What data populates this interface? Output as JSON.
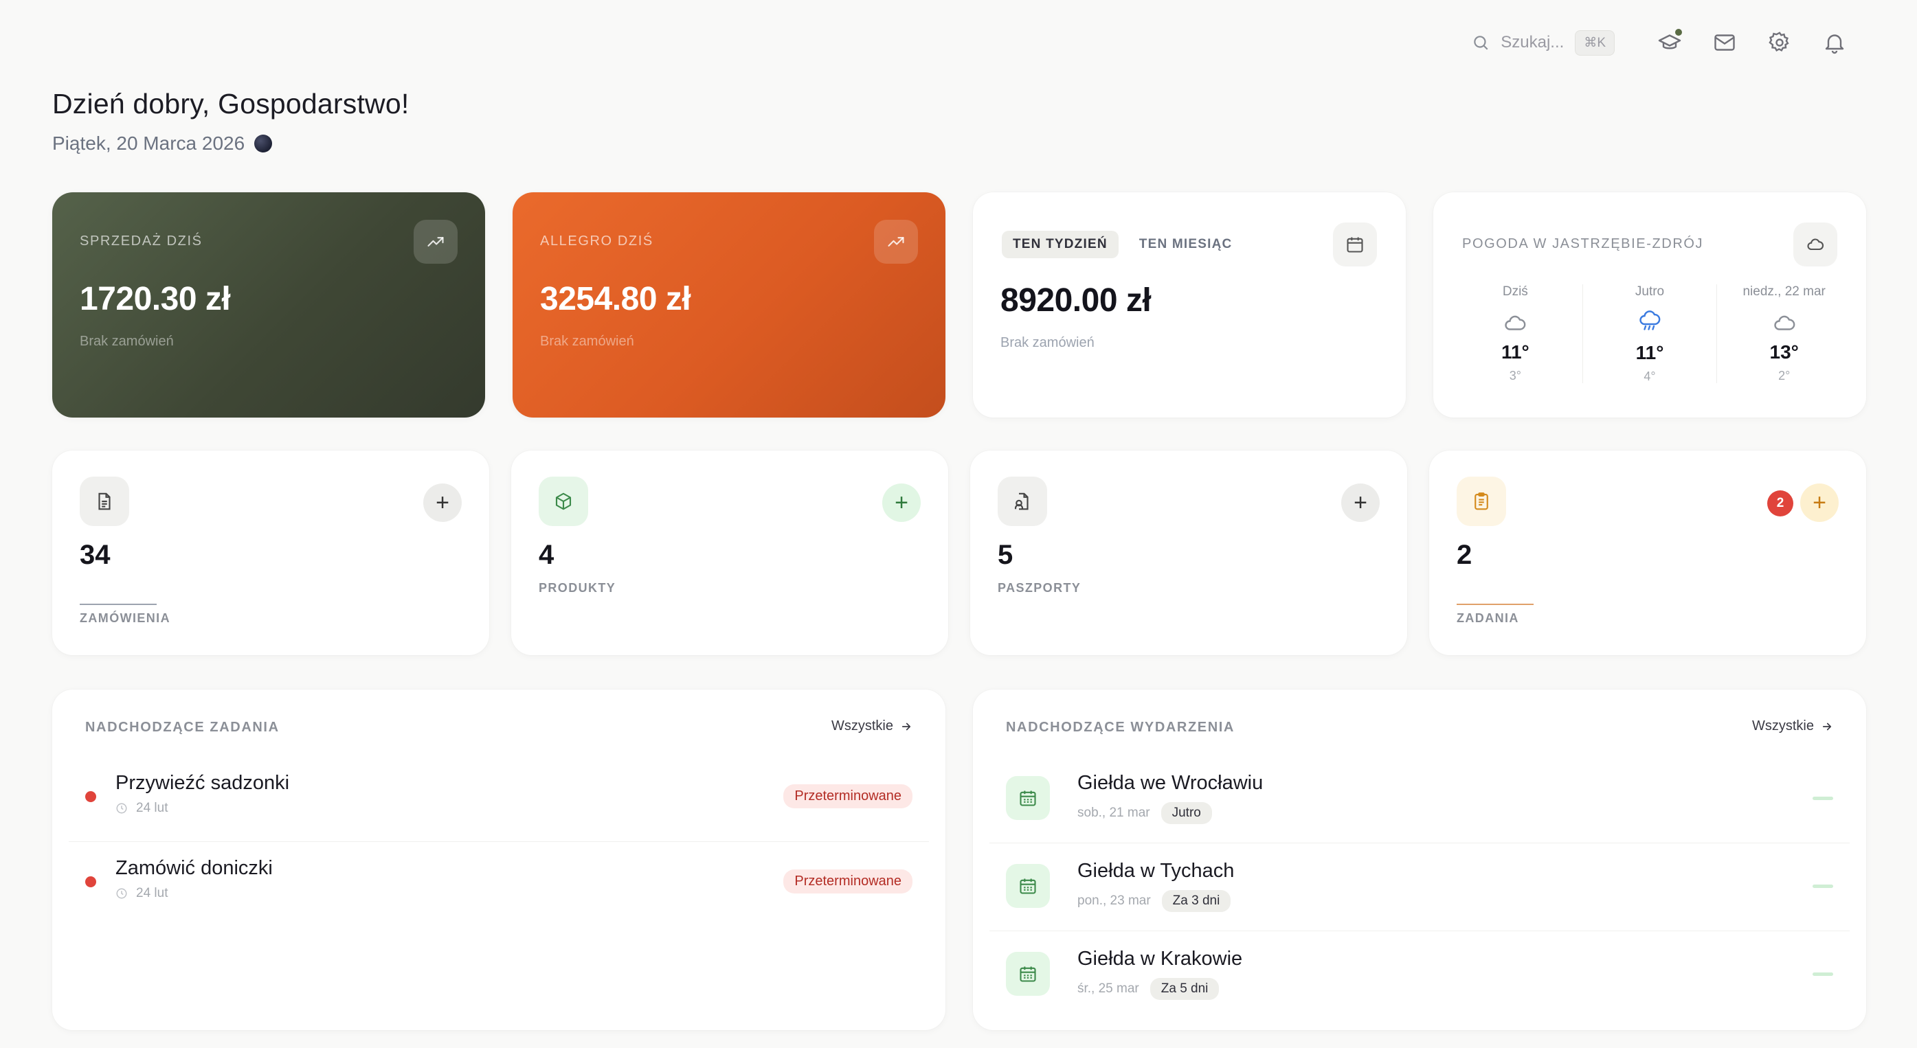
{
  "topbar": {
    "search_placeholder": "Szukaj...",
    "search_shortcut": "⌘K"
  },
  "greeting": {
    "title": "Dzień dobry, Gospodarstwo!",
    "date": "Piątek, 20 Marca 2026"
  },
  "sales_today": {
    "label": "SPRZEDAŻ DZIŚ",
    "value": "1720.30 zł",
    "sub": "Brak zamówień"
  },
  "allegro_today": {
    "label": "ALLEGRO DZIŚ",
    "value": "3254.80 zł",
    "sub": "Brak zamówień"
  },
  "period": {
    "tabs": [
      "TEN TYDZIEŃ",
      "TEN MIESIĄC"
    ],
    "active_tab": "TEN TYDZIEŃ",
    "value": "8920.00 zł",
    "sub": "Brak zamówień"
  },
  "weather": {
    "label": "POGODA W JASTRZĘBIE-ZDRÓJ",
    "days": [
      {
        "name": "Dziś",
        "icon": "cloud-icon",
        "high": "11°",
        "low": "3°"
      },
      {
        "name": "Jutro",
        "icon": "rain-cloud-icon",
        "high": "11°",
        "low": "4°"
      },
      {
        "name": "niedz., 22 mar",
        "icon": "cloud-icon",
        "high": "13°",
        "low": "2°"
      }
    ]
  },
  "stats": {
    "orders": {
      "value": "34",
      "label": "ZAMÓWIENIA",
      "icon": "document-icon"
    },
    "products": {
      "value": "4",
      "label": "PRODUKTY",
      "icon": "package-icon"
    },
    "passports": {
      "value": "5",
      "label": "PASZPORTY",
      "icon": "passport-file-icon"
    },
    "tasks": {
      "value": "2",
      "label": "ZADANIA",
      "icon": "clipboard-icon",
      "badge": "2"
    },
    "add_symbol": "+"
  },
  "upcoming_tasks": {
    "title": "NADCHODZĄCE ZADANIA",
    "all_label": "Wszystkie",
    "items": [
      {
        "title": "Przywieźć sadzonki",
        "date": "24 lut",
        "status": "Przeterminowane"
      },
      {
        "title": "Zamówić doniczki",
        "date": "24 lut",
        "status": "Przeterminowane"
      }
    ]
  },
  "upcoming_events": {
    "title": "NADCHODZĄCE WYDARZENIA",
    "all_label": "Wszystkie",
    "items": [
      {
        "title": "Giełda we Wrocławiu",
        "date": "sob., 21 mar",
        "relative": "Jutro"
      },
      {
        "title": "Giełda w Tychach",
        "date": "pon., 23 mar",
        "relative": "Za 3 dni"
      },
      {
        "title": "Giełda w Krakowie",
        "date": "śr., 25 mar",
        "relative": "Za 5 dni"
      }
    ]
  },
  "colors": {
    "green_card": "#3f4735",
    "orange_card": "#dc5b23",
    "overdue_red": "#e0443b",
    "event_green": "#e4f7e6"
  }
}
